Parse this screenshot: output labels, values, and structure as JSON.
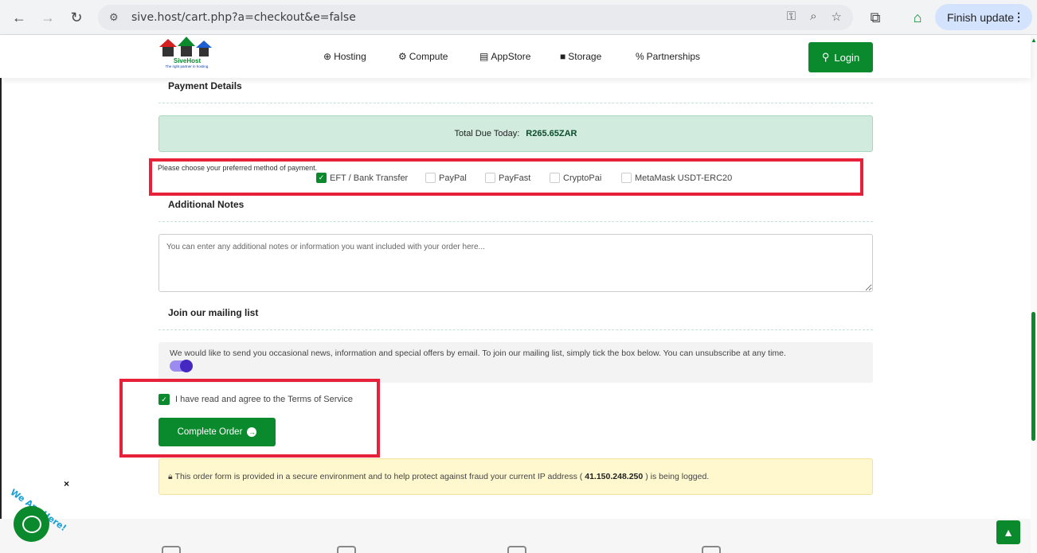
{
  "browser": {
    "url": "sive.host/cart.php?a=checkout&e=false",
    "finish_update": "Finish update",
    "icons": [
      "back-icon",
      "forward-icon",
      "reload-icon",
      "site-info-icon",
      "key-icon",
      "zoom-icon",
      "star-icon",
      "extensions-icon",
      "profile-icon",
      "menu-icon"
    ]
  },
  "site": {
    "logo_name": "SiveHost",
    "logo_tagline": "The right partner in hosting.",
    "nav": [
      {
        "icon": "⊕",
        "label": "Hosting"
      },
      {
        "icon": "⚙",
        "label": "Compute"
      },
      {
        "icon": "▤",
        "label": "AppStore"
      },
      {
        "icon": "■",
        "label": "Storage"
      },
      {
        "icon": "%",
        "label": "Partnerships"
      }
    ],
    "login_label": "Login"
  },
  "checkout": {
    "payment_details_title": "Payment Details",
    "total_label": "Total Due Today:",
    "total_amount": "R265.65ZAR",
    "payment_method_prompt": "Please choose your preferred method of payment.",
    "payment_methods": [
      {
        "label": "EFT / Bank Transfer",
        "checked": true
      },
      {
        "label": "PayPal",
        "checked": false
      },
      {
        "label": "PayFast",
        "checked": false
      },
      {
        "label": "CryptoPai",
        "checked": false
      },
      {
        "label": "MetaMask USDT-ERC20",
        "checked": false
      }
    ],
    "notes_title": "Additional Notes",
    "notes_placeholder": "You can enter any additional notes or information you want included with your order here...",
    "mailing_title": "Join our mailing list",
    "mailing_text": "We would like to send you occasional news, information and special offers by email. To join our mailing list, simply tick the box below. You can unsubscribe at any time.",
    "mailing_opt_in": true,
    "tos_label": "I have read and agree to the Terms of Service",
    "tos_checked": true,
    "complete_order_label": "Complete Order",
    "secure_text_before": "This order form is provided in a secure environment and to help protect against fraud your current IP address (",
    "secure_ip": "41.150.248.250",
    "secure_text_after": ") is being logged."
  },
  "chat": {
    "badge_text": "We Are Here!",
    "close_label": "×"
  },
  "colors": {
    "brand_green": "#0a8a2c",
    "highlight_red": "#e8213b",
    "toggle_purple": "#4527c2"
  }
}
